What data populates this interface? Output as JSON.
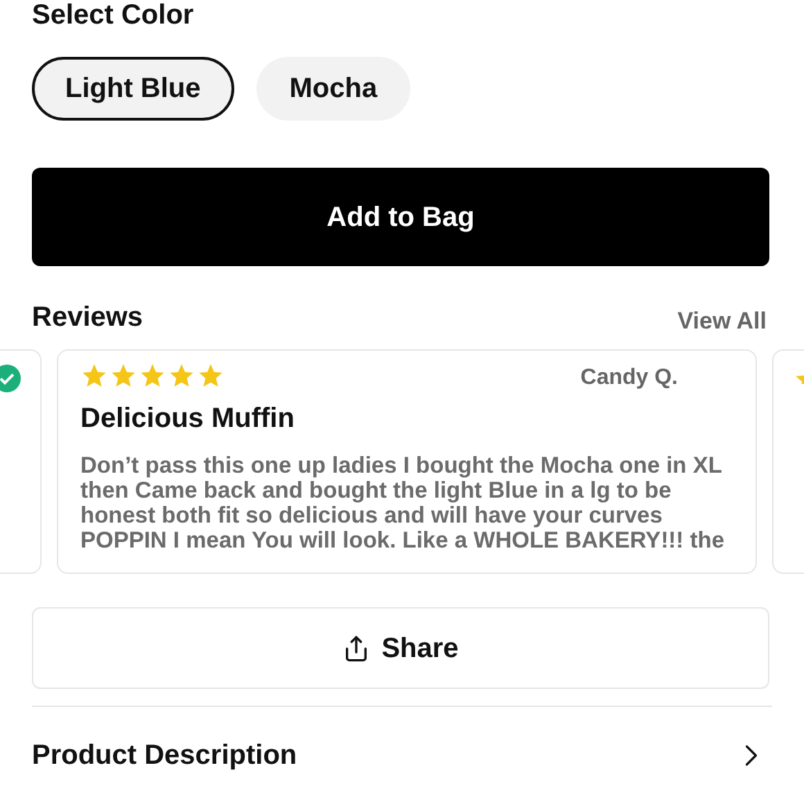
{
  "color_picker": {
    "label": "Select Color",
    "options": [
      {
        "label": "Light Blue",
        "selected": true
      },
      {
        "label": "Mocha",
        "selected": false
      }
    ]
  },
  "add_to_bag": {
    "label": "Add to Bag"
  },
  "reviews": {
    "title": "Reviews",
    "view_all": "View All",
    "cards": [
      {
        "kind": "partial_verified"
      },
      {
        "kind": "full",
        "stars": 5,
        "author": "Candy Q.",
        "title": "Delicious Muffin",
        "body": "Don’t pass this one up ladies I bought the Mocha one in XL then Came back and bought the light Blue in a lg to be honest both fit so delicious and will have your curves POPPIN I mean You will look. Like a WHOLE BAKERY!!! the"
      },
      {
        "kind": "partial_stars"
      }
    ]
  },
  "share": {
    "label": "Share"
  },
  "product_description": {
    "label": "Product Description"
  }
}
